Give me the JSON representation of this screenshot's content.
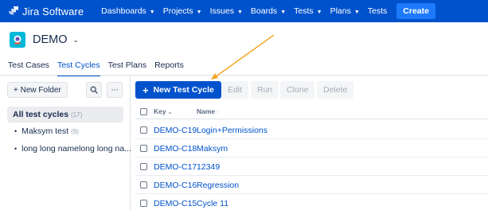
{
  "app": {
    "title": "Jira Software"
  },
  "nav": {
    "items": [
      "Dashboards",
      "Projects",
      "Issues",
      "Boards",
      "Tests",
      "Plans",
      "Tests"
    ],
    "create_label": "Create"
  },
  "project": {
    "name": "DEMO"
  },
  "tabs": [
    "Test Cases",
    "Test Cycles",
    "Test Plans",
    "Reports"
  ],
  "sidebar": {
    "new_folder_label": "+ New Folder",
    "all_label": "All test cycles",
    "all_count": "(17)",
    "folders": [
      {
        "label": "Maksym test",
        "count": "(9)"
      },
      {
        "label": "long long namelong long na...",
        "count": ""
      }
    ]
  },
  "toolbar": {
    "new_cycle_label": "New Test Cycle",
    "edit_label": "Edit",
    "run_label": "Run",
    "clone_label": "Clone",
    "delete_label": "Delete"
  },
  "table": {
    "columns": {
      "key": "Key",
      "name": "Name"
    },
    "rows": [
      {
        "key": "DEMO-C19",
        "name": "Login+Permissions"
      },
      {
        "key": "DEMO-C18",
        "name": "Maksym"
      },
      {
        "key": "DEMO-C17",
        "name": "12349"
      },
      {
        "key": "DEMO-C16",
        "name": "Regression"
      },
      {
        "key": "DEMO-C15",
        "name": "Cycle 11"
      }
    ]
  },
  "colors": {
    "brand": "#0052cc",
    "annotation": "#f5a623"
  }
}
